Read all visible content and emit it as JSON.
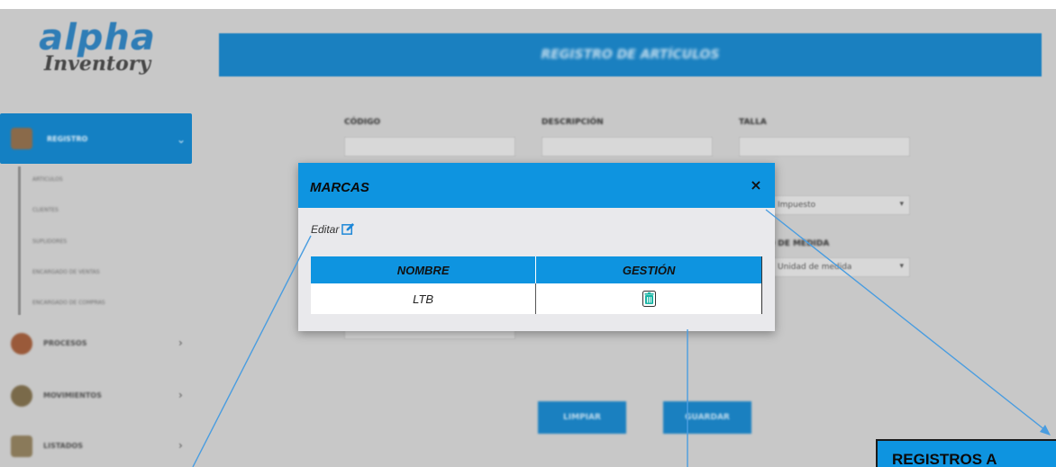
{
  "app": {
    "logo_main": "alpha",
    "logo_sub": "Inventory"
  },
  "sidebar": {
    "active_section": "REGISTRO",
    "sub_items": [
      "ARTÍCULOS",
      "CLIENTES",
      "SUPLIDORES",
      "ENCARGADO DE VENTAS",
      "ENCARGADO DE COMPRAS"
    ],
    "sections": [
      "PROCESOS",
      "MOVIMIENTOS",
      "LISTADOS"
    ]
  },
  "page": {
    "title": "REGISTRO DE ARTÍCULOS"
  },
  "form": {
    "labels": {
      "codigo": "CÓDIGO",
      "descripcion": "DESCRIPCIÓN",
      "talla": "TALLA",
      "unidad": "UNIDAD DE MEDIDA"
    },
    "selects": {
      "impuesto": "Impuesto",
      "unidad": "Unidad de medida"
    },
    "buttons": {
      "clear": "LIMPIAR",
      "save": "GUARDAR"
    }
  },
  "modal": {
    "title": "MARCAS",
    "close_glyph": "×",
    "edit_label": "Editar",
    "columns": [
      "NOMBRE",
      "GESTIÓN"
    ],
    "rows": [
      {
        "nombre": "LTB"
      }
    ]
  },
  "annotation": {
    "callout_text": "REGISTROS A",
    "line_color": "#4a9de0"
  },
  "colors": {
    "accent": "#0e94e0",
    "header_blue": "#1a80c0",
    "overlay_gray": "#c8c8c8",
    "trash_teal": "#19b5a5"
  }
}
